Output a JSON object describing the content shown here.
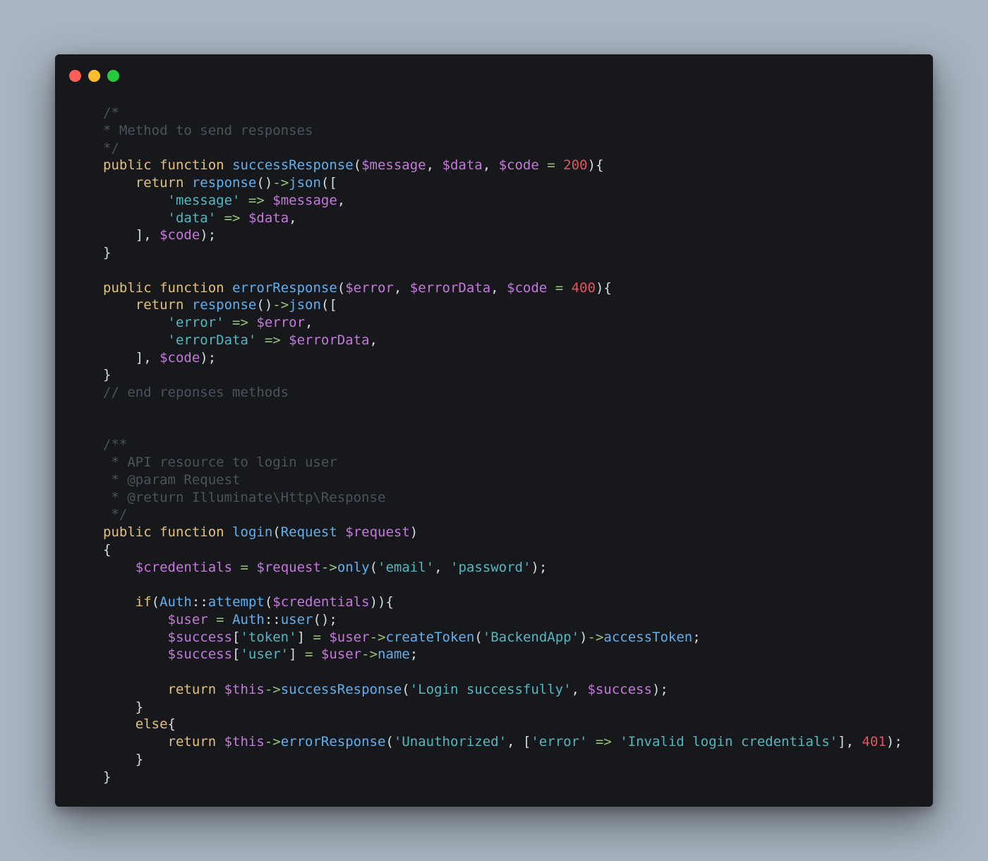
{
  "window": {
    "controls": [
      "close",
      "minimize",
      "maximize"
    ]
  },
  "colors": {
    "background": "#a8b4c0",
    "editor": "#16181b",
    "comment": "#4b535d",
    "keyword": "#e5c07b",
    "function": "#61afef",
    "variable": "#c678dd",
    "string": "#56b6c2",
    "number": "#e05561",
    "operator": "#98c379",
    "plain": "#d7dae0"
  },
  "code": {
    "lines": [
      [
        [
          "comment",
          "/*"
        ]
      ],
      [
        [
          "comment",
          "* Method to send responses"
        ]
      ],
      [
        [
          "comment",
          "*/"
        ]
      ],
      [
        [
          "keyword",
          "public"
        ],
        [
          "plain",
          " "
        ],
        [
          "keyword",
          "function"
        ],
        [
          "plain",
          " "
        ],
        [
          "func",
          "successResponse"
        ],
        [
          "plain",
          "("
        ],
        [
          "var",
          "$message"
        ],
        [
          "plain",
          ", "
        ],
        [
          "var",
          "$data"
        ],
        [
          "plain",
          ", "
        ],
        [
          "var",
          "$code"
        ],
        [
          "plain",
          " "
        ],
        [
          "op",
          "="
        ],
        [
          "plain",
          " "
        ],
        [
          "number",
          "200"
        ],
        [
          "plain",
          "){"
        ]
      ],
      [
        [
          "plain",
          "    "
        ],
        [
          "keyword",
          "return"
        ],
        [
          "plain",
          " "
        ],
        [
          "func",
          "response"
        ],
        [
          "plain",
          "()"
        ],
        [
          "op",
          "->"
        ],
        [
          "func",
          "json"
        ],
        [
          "plain",
          "(["
        ]
      ],
      [
        [
          "plain",
          "        "
        ],
        [
          "string",
          "'message'"
        ],
        [
          "plain",
          " "
        ],
        [
          "op",
          "=>"
        ],
        [
          "plain",
          " "
        ],
        [
          "var",
          "$message"
        ],
        [
          "plain",
          ","
        ]
      ],
      [
        [
          "plain",
          "        "
        ],
        [
          "string",
          "'data'"
        ],
        [
          "plain",
          " "
        ],
        [
          "op",
          "=>"
        ],
        [
          "plain",
          " "
        ],
        [
          "var",
          "$data"
        ],
        [
          "plain",
          ","
        ]
      ],
      [
        [
          "plain",
          "    ], "
        ],
        [
          "var",
          "$code"
        ],
        [
          "plain",
          ");"
        ]
      ],
      [
        [
          "plain",
          "}"
        ]
      ],
      [],
      [
        [
          "keyword",
          "public"
        ],
        [
          "plain",
          " "
        ],
        [
          "keyword",
          "function"
        ],
        [
          "plain",
          " "
        ],
        [
          "func",
          "errorResponse"
        ],
        [
          "plain",
          "("
        ],
        [
          "var",
          "$error"
        ],
        [
          "plain",
          ", "
        ],
        [
          "var",
          "$errorData"
        ],
        [
          "plain",
          ", "
        ],
        [
          "var",
          "$code"
        ],
        [
          "plain",
          " "
        ],
        [
          "op",
          "="
        ],
        [
          "plain",
          " "
        ],
        [
          "number",
          "400"
        ],
        [
          "plain",
          "){"
        ]
      ],
      [
        [
          "plain",
          "    "
        ],
        [
          "keyword",
          "return"
        ],
        [
          "plain",
          " "
        ],
        [
          "func",
          "response"
        ],
        [
          "plain",
          "()"
        ],
        [
          "op",
          "->"
        ],
        [
          "func",
          "json"
        ],
        [
          "plain",
          "(["
        ]
      ],
      [
        [
          "plain",
          "        "
        ],
        [
          "string",
          "'error'"
        ],
        [
          "plain",
          " "
        ],
        [
          "op",
          "=>"
        ],
        [
          "plain",
          " "
        ],
        [
          "var",
          "$error"
        ],
        [
          "plain",
          ","
        ]
      ],
      [
        [
          "plain",
          "        "
        ],
        [
          "string",
          "'errorData'"
        ],
        [
          "plain",
          " "
        ],
        [
          "op",
          "=>"
        ],
        [
          "plain",
          " "
        ],
        [
          "var",
          "$errorData"
        ],
        [
          "plain",
          ","
        ]
      ],
      [
        [
          "plain",
          "    ], "
        ],
        [
          "var",
          "$code"
        ],
        [
          "plain",
          ");"
        ]
      ],
      [
        [
          "plain",
          "}"
        ]
      ],
      [
        [
          "comment",
          "// end reponses methods"
        ]
      ],
      [],
      [],
      [
        [
          "comment",
          "/**"
        ]
      ],
      [
        [
          "comment",
          " * API resource to login user"
        ]
      ],
      [
        [
          "comment",
          " * @param Request"
        ]
      ],
      [
        [
          "comment",
          " * @return Illuminate\\Http\\Response"
        ]
      ],
      [
        [
          "comment",
          " */"
        ]
      ],
      [
        [
          "keyword",
          "public"
        ],
        [
          "plain",
          " "
        ],
        [
          "keyword",
          "function"
        ],
        [
          "plain",
          " "
        ],
        [
          "func",
          "login"
        ],
        [
          "plain",
          "("
        ],
        [
          "func",
          "Request"
        ],
        [
          "plain",
          " "
        ],
        [
          "var",
          "$request"
        ],
        [
          "plain",
          ")"
        ]
      ],
      [
        [
          "plain",
          "{"
        ]
      ],
      [
        [
          "plain",
          "    "
        ],
        [
          "var",
          "$credentials"
        ],
        [
          "plain",
          " "
        ],
        [
          "op",
          "="
        ],
        [
          "plain",
          " "
        ],
        [
          "var",
          "$request"
        ],
        [
          "op",
          "->"
        ],
        [
          "func",
          "only"
        ],
        [
          "plain",
          "("
        ],
        [
          "string",
          "'email'"
        ],
        [
          "plain",
          ", "
        ],
        [
          "string",
          "'password'"
        ],
        [
          "plain",
          ");"
        ]
      ],
      [],
      [
        [
          "plain",
          "    "
        ],
        [
          "keyword",
          "if"
        ],
        [
          "plain",
          "("
        ],
        [
          "func",
          "Auth"
        ],
        [
          "plain",
          "::"
        ],
        [
          "func",
          "attempt"
        ],
        [
          "plain",
          "("
        ],
        [
          "var",
          "$credentials"
        ],
        [
          "plain",
          ")){"
        ]
      ],
      [
        [
          "plain",
          "        "
        ],
        [
          "var",
          "$user"
        ],
        [
          "plain",
          " "
        ],
        [
          "op",
          "="
        ],
        [
          "plain",
          " "
        ],
        [
          "func",
          "Auth"
        ],
        [
          "plain",
          "::"
        ],
        [
          "func",
          "user"
        ],
        [
          "plain",
          "();"
        ]
      ],
      [
        [
          "plain",
          "        "
        ],
        [
          "var",
          "$success"
        ],
        [
          "plain",
          "["
        ],
        [
          "string",
          "'token'"
        ],
        [
          "plain",
          "] "
        ],
        [
          "op",
          "="
        ],
        [
          "plain",
          " "
        ],
        [
          "var",
          "$user"
        ],
        [
          "op",
          "->"
        ],
        [
          "func",
          "createToken"
        ],
        [
          "plain",
          "("
        ],
        [
          "string",
          "'BackendApp'"
        ],
        [
          "plain",
          ")"
        ],
        [
          "op",
          "->"
        ],
        [
          "func",
          "accessToken"
        ],
        [
          "plain",
          ";"
        ]
      ],
      [
        [
          "plain",
          "        "
        ],
        [
          "var",
          "$success"
        ],
        [
          "plain",
          "["
        ],
        [
          "string",
          "'user'"
        ],
        [
          "plain",
          "] "
        ],
        [
          "op",
          "="
        ],
        [
          "plain",
          " "
        ],
        [
          "var",
          "$user"
        ],
        [
          "op",
          "->"
        ],
        [
          "func",
          "name"
        ],
        [
          "plain",
          ";"
        ]
      ],
      [],
      [
        [
          "plain",
          "        "
        ],
        [
          "keyword",
          "return"
        ],
        [
          "plain",
          " "
        ],
        [
          "var",
          "$this"
        ],
        [
          "op",
          "->"
        ],
        [
          "func",
          "successResponse"
        ],
        [
          "plain",
          "("
        ],
        [
          "string",
          "'Login successfully'"
        ],
        [
          "plain",
          ", "
        ],
        [
          "var",
          "$success"
        ],
        [
          "plain",
          ");"
        ]
      ],
      [
        [
          "plain",
          "    }"
        ]
      ],
      [
        [
          "plain",
          "    "
        ],
        [
          "keyword",
          "else"
        ],
        [
          "plain",
          "{"
        ]
      ],
      [
        [
          "plain",
          "        "
        ],
        [
          "keyword",
          "return"
        ],
        [
          "plain",
          " "
        ],
        [
          "var",
          "$this"
        ],
        [
          "op",
          "->"
        ],
        [
          "func",
          "errorResponse"
        ],
        [
          "plain",
          "("
        ],
        [
          "string",
          "'Unauthorized'"
        ],
        [
          "plain",
          ", ["
        ],
        [
          "string",
          "'error'"
        ],
        [
          "plain",
          " "
        ],
        [
          "op",
          "=>"
        ],
        [
          "plain",
          " "
        ],
        [
          "string",
          "'Invalid login credentials'"
        ],
        [
          "plain",
          "], "
        ],
        [
          "number",
          "401"
        ],
        [
          "plain",
          ");"
        ]
      ],
      [
        [
          "plain",
          "    }"
        ]
      ],
      [
        [
          "plain",
          "}"
        ]
      ]
    ]
  }
}
